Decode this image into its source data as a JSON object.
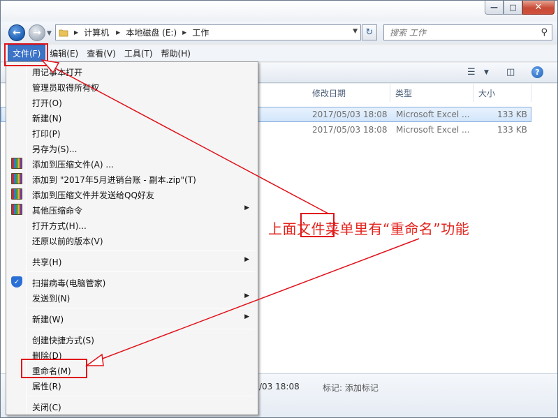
{
  "window": {
    "caption_buttons": {
      "minimize": "—",
      "maximize": "□",
      "close": "✕"
    }
  },
  "address_bar": {
    "crumbs": [
      "计算机",
      "本地磁盘 (E:)",
      "工作"
    ],
    "search_placeholder": "搜索 工作"
  },
  "menubar": {
    "items": [
      "文件(F)",
      "编辑(E)",
      "查看(V)",
      "工具(T)",
      "帮助(H)"
    ],
    "active_index": 0
  },
  "columns": {
    "modified": "修改日期",
    "type": "类型",
    "size": "大小"
  },
  "files": [
    {
      "modified": "2017/05/03 18:08",
      "type": "Microsoft Excel ...",
      "size": "133 KB",
      "selected": true
    },
    {
      "modified": "2017/05/03 18:08",
      "type": "Microsoft Excel ...",
      "size": "133 KB",
      "selected": false
    }
  ],
  "details": {
    "date": "/03 18:08",
    "tag_label": "标记: 添加标记"
  },
  "file_menu": {
    "items": [
      "用记事本打开",
      "管理员取得所有权",
      "打开(O)",
      "新建(N)",
      "打印(P)",
      "另存为(S)...",
      "添加到压缩文件(A) ...",
      "添加到 \"2017年5月进销台账 - 副本.zip\"(T)",
      "添加到压缩文件并发送给QQ好友",
      "其他压缩命令",
      "打开方式(H)...",
      "还原以前的版本(V)",
      "共享(H)",
      "扫描病毒(电脑管家)",
      "发送到(N)",
      "新建(W)",
      "创建快捷方式(S)",
      "删除(D)",
      "重命名(M)",
      "属性(R)",
      "关闭(C)"
    ]
  },
  "annotation": {
    "text_before": "上面",
    "text_boxed": "文件",
    "text_after": "菜单里有“重命名”功能",
    "color": "#e3231c"
  },
  "colors": {
    "accent": "#3b73c7",
    "annotation": "#e0121a",
    "selection": "#d3e6fb"
  }
}
